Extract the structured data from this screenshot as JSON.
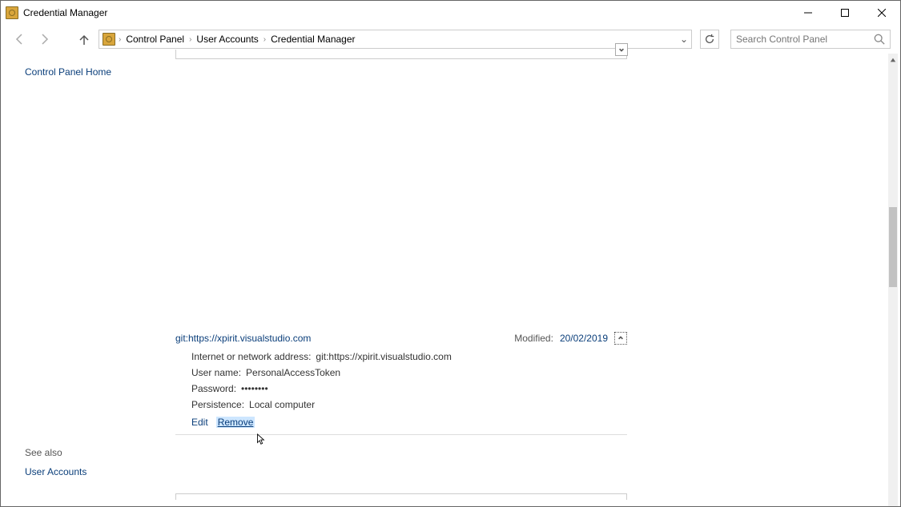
{
  "window": {
    "title": "Credential Manager"
  },
  "breadcrumb": {
    "part1": "Control Panel",
    "part2": "User Accounts",
    "part3": "Credential Manager"
  },
  "search": {
    "placeholder": "Search Control Panel"
  },
  "left_panel": {
    "home_link": "Control Panel Home",
    "see_also_label": "See also",
    "user_accounts_link": "User Accounts"
  },
  "credential": {
    "title": "git:https://xpirit.visualstudio.com",
    "modified_label": "Modified:",
    "modified_date": "20/02/2019",
    "details": {
      "address_label": "Internet or network address:",
      "address_value": "git:https://xpirit.visualstudio.com",
      "username_label": "User name:",
      "username_value": "PersonalAccessToken",
      "password_label": "Password:",
      "password_value": "••••••••",
      "persistence_label": "Persistence:",
      "persistence_value": "Local computer"
    },
    "actions": {
      "edit": "Edit",
      "remove": "Remove"
    }
  }
}
